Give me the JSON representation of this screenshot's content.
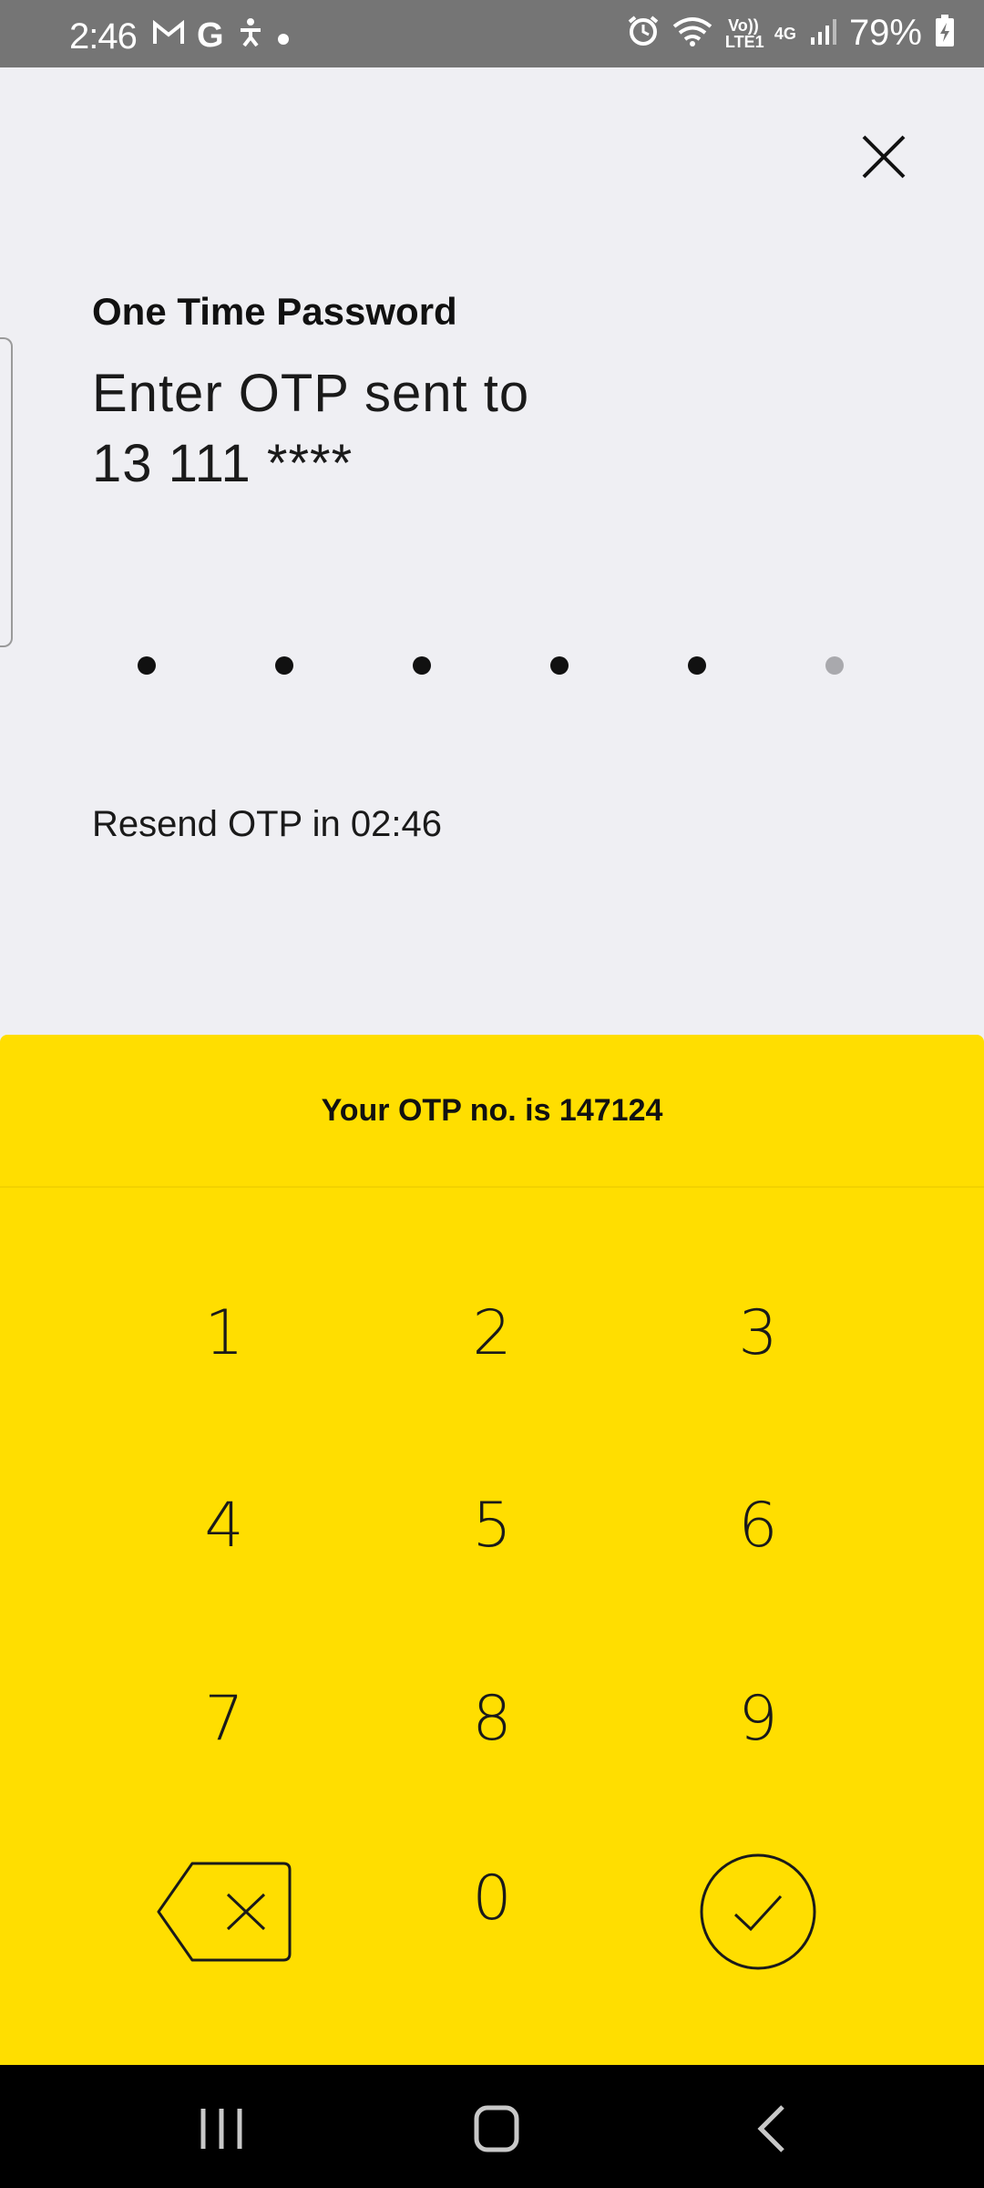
{
  "status_bar": {
    "time": "2:46",
    "left_icons": [
      "gmail-icon",
      "google-icon",
      "accessibility-icon",
      "dot-icon"
    ],
    "right_icons": [
      "alarm-icon",
      "wifi-icon",
      "volte-icon",
      "4g-icon",
      "signal-icon"
    ],
    "volte_label": "Vo)) LTE1",
    "network_label": "4G",
    "battery": "79%"
  },
  "header": {
    "subtitle": "One Time Password",
    "title_line1": "Enter OTP sent to",
    "title_line2": "13 111 ****"
  },
  "otp": {
    "digits_entered": 5,
    "digits_total": 6
  },
  "resend": {
    "text": "Resend OTP in 02:46"
  },
  "keypad": {
    "banner": "Your OTP no. is 147124",
    "keys": [
      "1",
      "2",
      "3",
      "4",
      "5",
      "6",
      "7",
      "8",
      "9",
      "0"
    ],
    "backspace_icon": "backspace-icon",
    "confirm_icon": "check-icon",
    "accent_color": "#ffde00"
  },
  "nav_bar": {
    "icons": [
      "recents-icon",
      "home-icon",
      "back-icon"
    ]
  }
}
